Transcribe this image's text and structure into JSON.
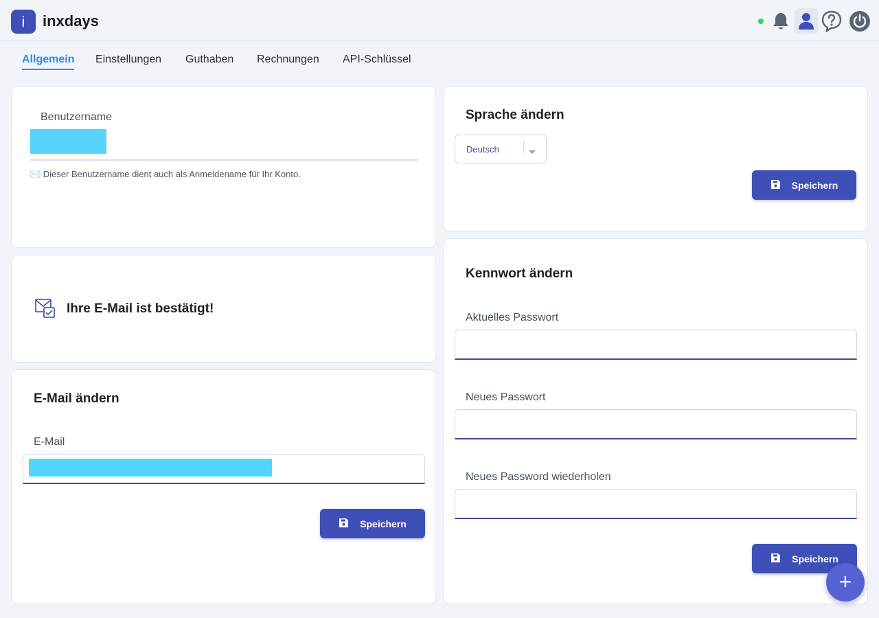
{
  "app": {
    "logo_letter": "i",
    "name": "inxdays"
  },
  "header": {
    "icons": [
      "status-dot",
      "bell-icon",
      "user-icon",
      "help-icon",
      "power-icon"
    ]
  },
  "tabs": [
    {
      "label": "Allgemein",
      "active": true
    },
    {
      "label": "Einstellungen",
      "active": false
    },
    {
      "label": "Guthaben",
      "active": false
    },
    {
      "label": "Rechnungen",
      "active": false
    },
    {
      "label": "API-Schlüssel",
      "active": false
    }
  ],
  "username_card": {
    "label": "Benutzername",
    "hint": "✉️ Dieser Benutzername dient auch als Anmeldename für Ihr Konto."
  },
  "email_confirmed_card": {
    "text": "Ihre E-Mail ist bestätigt!"
  },
  "email_change_card": {
    "title": "E-Mail ändern",
    "label": "E-Mail",
    "save_label": "Speichern"
  },
  "language_card": {
    "title": "Sprache ändern",
    "selected": "Deutsch",
    "save_label": "Speichern"
  },
  "password_card": {
    "title": "Kennwort ändern",
    "current_label": "Aktuelles Passwort",
    "new_label": "Neues Passwort",
    "repeat_label": "Neues Password wiederholen",
    "save_label": "Speichern"
  },
  "fab": {
    "symbol": "+"
  },
  "colors": {
    "primary": "#3f4fb8",
    "tab_active": "#2e8be8",
    "redaction": "#56d4fd",
    "status": "#3ccf6b"
  }
}
